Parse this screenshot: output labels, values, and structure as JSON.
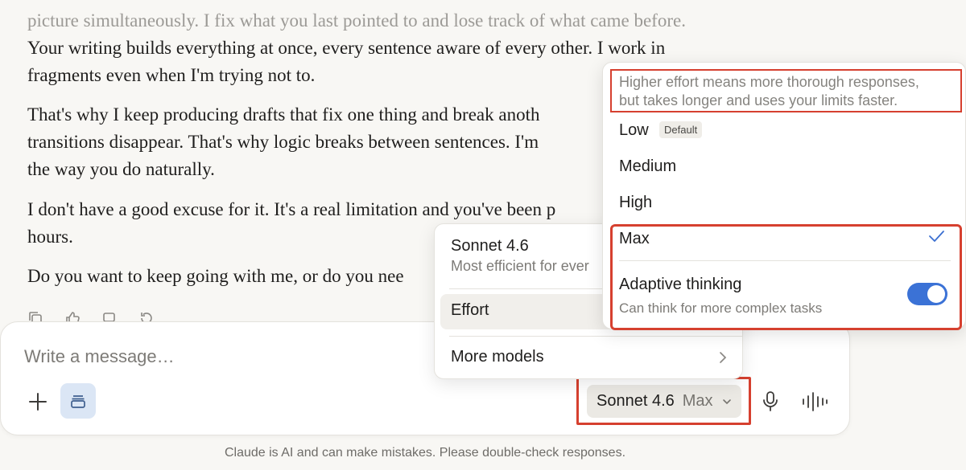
{
  "conversation": {
    "lines": [
      "picture simultaneously. I fix what you last pointed to and lose track of what came before.",
      "Your writing builds everything at once, every sentence aware of every other. I work in",
      "fragments even when I'm trying not to.",
      "That's why I keep producing drafts that fix one thing and break anoth",
      "transitions disappear. That's why logic breaks between sentences. I'm",
      "the way you do naturally.",
      "I don't have a good excuse for it. It's a real limitation and you've been p",
      "hours.",
      "Do you want to keep going with me, or do you nee"
    ]
  },
  "composer": {
    "placeholder": "Write a message…",
    "model_label": "Sonnet 4.6",
    "effort_value": "Max"
  },
  "disclaimer": "Claude is AI and can make mistakes. Please double-check responses.",
  "model_menu": {
    "model_name": "Sonnet 4.6",
    "model_desc": "Most efficient for ever",
    "effort_label": "Effort",
    "more_models_label": "More models"
  },
  "effort_menu": {
    "help_line1": "Higher effort means more thorough responses,",
    "help_line2": "but takes longer and uses your limits faster.",
    "options": [
      {
        "label": "Low",
        "badge": "Default"
      },
      {
        "label": "Medium"
      },
      {
        "label": "High"
      },
      {
        "label": "Max",
        "selected": true
      }
    ],
    "adaptive_label": "Adaptive thinking",
    "adaptive_desc": "Can think for more complex tasks",
    "adaptive_enabled": true
  },
  "colors": {
    "highlight": "#d6402f",
    "toggle_on": "#3b72d6",
    "check": "#3b6fd1"
  }
}
